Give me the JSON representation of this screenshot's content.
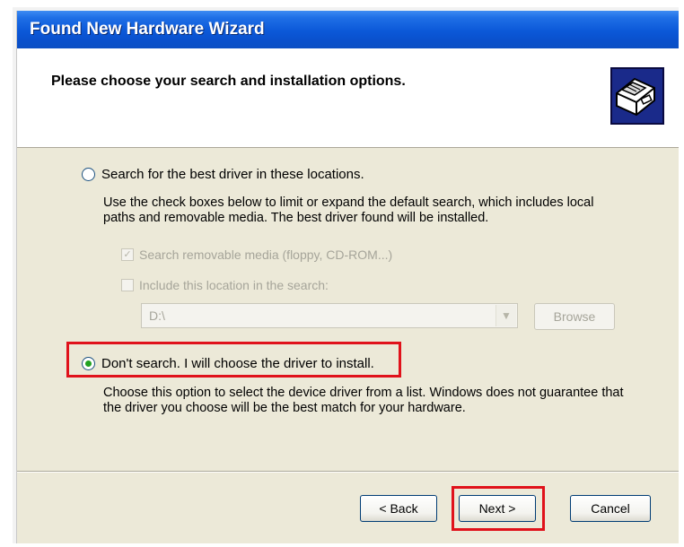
{
  "window": {
    "title": "Found New Hardware Wizard"
  },
  "header": {
    "title": "Please choose your search and installation options.",
    "icon": "hardware-install-icon"
  },
  "options": {
    "search": {
      "label": "Search for the best driver in these locations.",
      "selected": false,
      "description_line1": "Use the check boxes below to limit or expand the default search, which includes local",
      "description_line2": "paths and removable media. The best driver found will be installed."
    },
    "removable_media": {
      "label": "Search removable media (floppy, CD-ROM...)",
      "checked": true,
      "enabled": false
    },
    "include_location": {
      "label": "Include this location in the search:",
      "checked": false,
      "enabled": false
    },
    "location_combo": {
      "value": "D:\\"
    },
    "browse_label": "Browse",
    "dont_search": {
      "label": "Don't search. I will choose the driver to install.",
      "selected": true,
      "description_line1": "Choose this option to select the device driver from a list.  Windows does not guarantee that",
      "description_line2": "the driver you choose will be the best match for your hardware."
    }
  },
  "buttons": {
    "back": "< Back",
    "next": "Next >",
    "cancel": "Cancel"
  },
  "colors": {
    "titlebar": "#0b58d8",
    "window_bg": "#ece9d8",
    "highlight_box": "#e0121b"
  }
}
